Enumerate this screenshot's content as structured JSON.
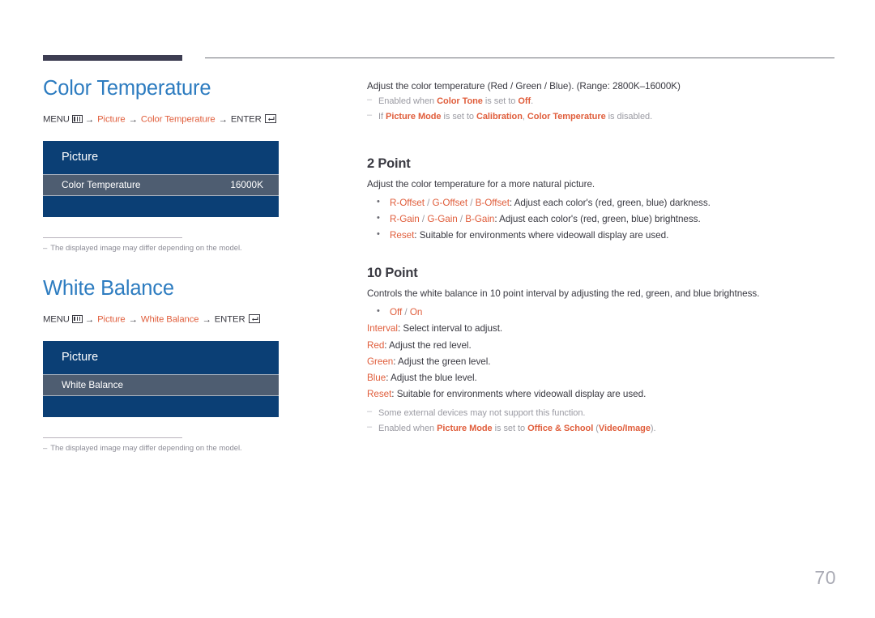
{
  "page": {
    "number": "70"
  },
  "left": {
    "section1": {
      "title": "Color Temperature",
      "path": {
        "menu_label": "MENU",
        "menu_icon": "menu-grid-icon",
        "arrow": "→",
        "crumb1": "Picture",
        "crumb2": "Color Temperature",
        "enter_label": "ENTER",
        "enter_icon": "enter-key-icon"
      },
      "osd": {
        "header": "Picture",
        "row_label": "Color Temperature",
        "row_value": "16000K"
      },
      "note": "The displayed image may differ depending on the model.",
      "note_dash": "–"
    },
    "section2": {
      "title": "White Balance",
      "path": {
        "menu_label": "MENU",
        "menu_icon": "menu-grid-icon",
        "arrow": "→",
        "crumb1": "Picture",
        "crumb2": "White Balance",
        "enter_label": "ENTER",
        "enter_icon": "enter-key-icon"
      },
      "osd": {
        "header": "Picture",
        "row_label": "White Balance",
        "row_value": ""
      },
      "note": "The displayed image may differ depending on the model.",
      "note_dash": "–"
    }
  },
  "right": {
    "intro": {
      "lead": "Adjust the color temperature (Red / Green / Blue). (Range: 2800K–16000K)",
      "note1": {
        "pre": "Enabled when ",
        "term1": "Color Tone",
        "mid": " is set to ",
        "term2": "Off",
        "post": "."
      },
      "note2": {
        "pre": "If ",
        "term1": "Picture Mode",
        "mid": " is set to ",
        "term2": "Calibration",
        "mid2": ", ",
        "term3": "Color Temperature",
        "post": " is disabled."
      }
    },
    "two_point": {
      "title": "2 Point",
      "lead": "Adjust the color temperature for a more natural picture.",
      "items": [
        {
          "terms": [
            "R-Offset",
            "G-Offset",
            "B-Offset"
          ],
          "separator": " / ",
          "desc": ": Adjust each color's (red, green, blue) darkness."
        },
        {
          "terms": [
            "R-Gain",
            "G-Gain",
            "B-Gain"
          ],
          "separator": " / ",
          "desc": ": Adjust each color's (red, green, blue) brightness."
        },
        {
          "terms": [
            "Reset"
          ],
          "separator": " / ",
          "desc": ": Suitable for environments where videowall display are used."
        }
      ]
    },
    "ten_point": {
      "title": "10 Point",
      "lead": "Controls the white balance in 10 point interval by adjusting the red, green, and blue brightness.",
      "toggle": {
        "off": "Off",
        "separator": " / ",
        "on": "On"
      },
      "terms": [
        {
          "term": "Interval",
          "desc": ": Select interval to adjust."
        },
        {
          "term": "Red",
          "desc": ": Adjust the red level."
        },
        {
          "term": "Green",
          "desc": ": Adjust the green level."
        },
        {
          "term": "Blue",
          "desc": ": Adjust the blue level."
        },
        {
          "term": "Reset",
          "desc": ": Suitable for environments where videowall display are used."
        }
      ],
      "note1": "Some external devices may not support this function.",
      "note2": {
        "pre": "Enabled when ",
        "term1": "Picture Mode",
        "mid": " is set to ",
        "term2": "Office & School",
        "mid2": " (",
        "term3": "Video/Image",
        "post": ")."
      }
    }
  },
  "colors": {
    "heading_blue": "#2d7cc0",
    "accent_orange": "#e05e3c",
    "osd_header_blue": "#0b3f75",
    "osd_row_gray": "#4e5d71",
    "rule_dark": "#3d3d52",
    "muted_gray": "#9b9ba3"
  }
}
